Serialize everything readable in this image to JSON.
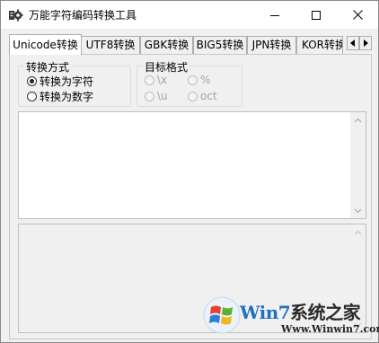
{
  "window": {
    "title": "万能字符编码转换工具"
  },
  "tabs": [
    {
      "label": "Unicode转换"
    },
    {
      "label": "UTF8转换"
    },
    {
      "label": "GBK转换"
    },
    {
      "label": "BIG5转换"
    },
    {
      "label": "JPN转换"
    },
    {
      "label": "KOR转换"
    }
  ],
  "conversion_mode": {
    "title": "转换方式",
    "options": [
      {
        "label": "转换为字符",
        "selected": true
      },
      {
        "label": "转换为数字",
        "selected": false
      }
    ]
  },
  "target_format": {
    "title": "目标格式",
    "options": [
      {
        "label": "\\x"
      },
      {
        "label": "%"
      },
      {
        "label": "\\u"
      },
      {
        "label": "oct"
      }
    ]
  },
  "input_text": {
    "value": ""
  },
  "output_text": {
    "value": ""
  },
  "watermark": {
    "brand_part1": "Win7",
    "brand_part2": "系统之家",
    "url": "Www.Winwin7.com"
  }
}
